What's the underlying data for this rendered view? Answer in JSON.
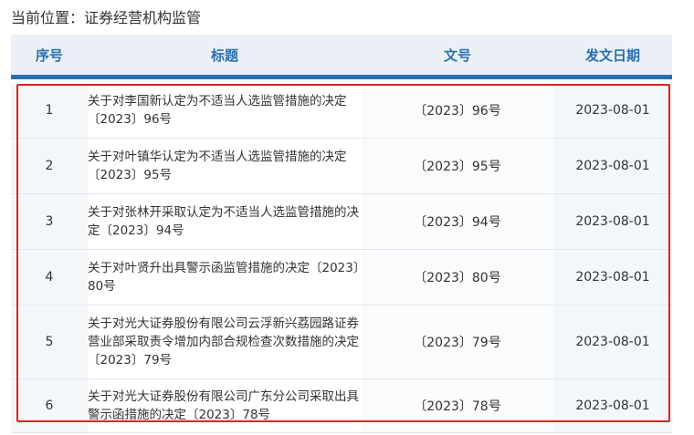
{
  "breadcrumb": {
    "text": "当前位置：证券经营机构监管"
  },
  "table": {
    "headers": {
      "index": "序号",
      "title": "标题",
      "doc_no": "文号",
      "date": "发文日期"
    },
    "rows": [
      {
        "index": "1",
        "title": "关于对李国新认定为不适当人选监管措施的决定〔2023〕96号",
        "doc_no": "〔2023〕96号",
        "date": "2023-08-01"
      },
      {
        "index": "2",
        "title": "关于对叶镇华认定为不适当人选监管措施的决定〔2023〕95号",
        "doc_no": "〔2023〕95号",
        "date": "2023-08-01"
      },
      {
        "index": "3",
        "title": "关于对张林开采取认定为不适当人选监管措施的决定〔2023〕94号",
        "doc_no": "〔2023〕94号",
        "date": "2023-08-01"
      },
      {
        "index": "4",
        "title": "关于对叶贤升出具警示函监管措施的决定〔2023〕80号",
        "doc_no": "〔2023〕80号",
        "date": "2023-08-01"
      },
      {
        "index": "5",
        "title": "关于对光大证券股份有限公司云浮新兴荔园路证券营业部采取责令增加内部合规检查次数措施的决定〔2023〕79号",
        "doc_no": "〔2023〕79号",
        "date": "2023-08-01"
      },
      {
        "index": "6",
        "title": "关于对光大证券股份有限公司广东分公司采取出具警示函措施的决定〔2023〕78号",
        "doc_no": "〔2023〕78号",
        "date": "2023-08-01"
      }
    ]
  },
  "colors": {
    "header_text": "#2a6fab",
    "header_bg": "#eaf0f6",
    "highlight_border": "#e02020"
  }
}
